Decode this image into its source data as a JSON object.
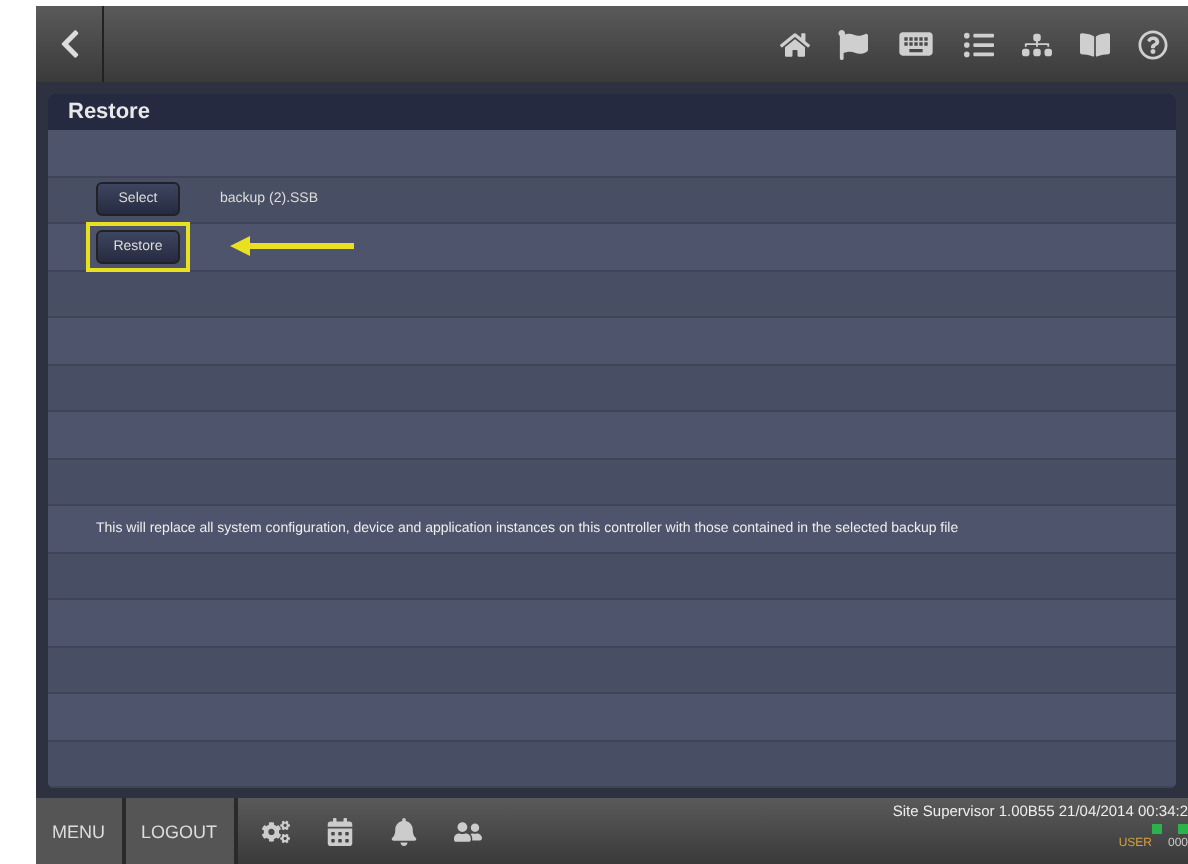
{
  "panel": {
    "title": "Restore"
  },
  "select_button": {
    "label": "Select"
  },
  "file_name": "backup (2).SSB",
  "restore_button": {
    "label": "Restore",
    "highlighted": true
  },
  "message": "This will replace all system configuration, device and application instances on this controller with those contained in the selected backup file",
  "bottom_bar": {
    "buttons": [
      "MENU",
      "LOGOUT"
    ],
    "version": "Site Supervisor 1.00B55 21/04/2014 00:34:2",
    "user_label": "USER",
    "user_value": "000"
  }
}
